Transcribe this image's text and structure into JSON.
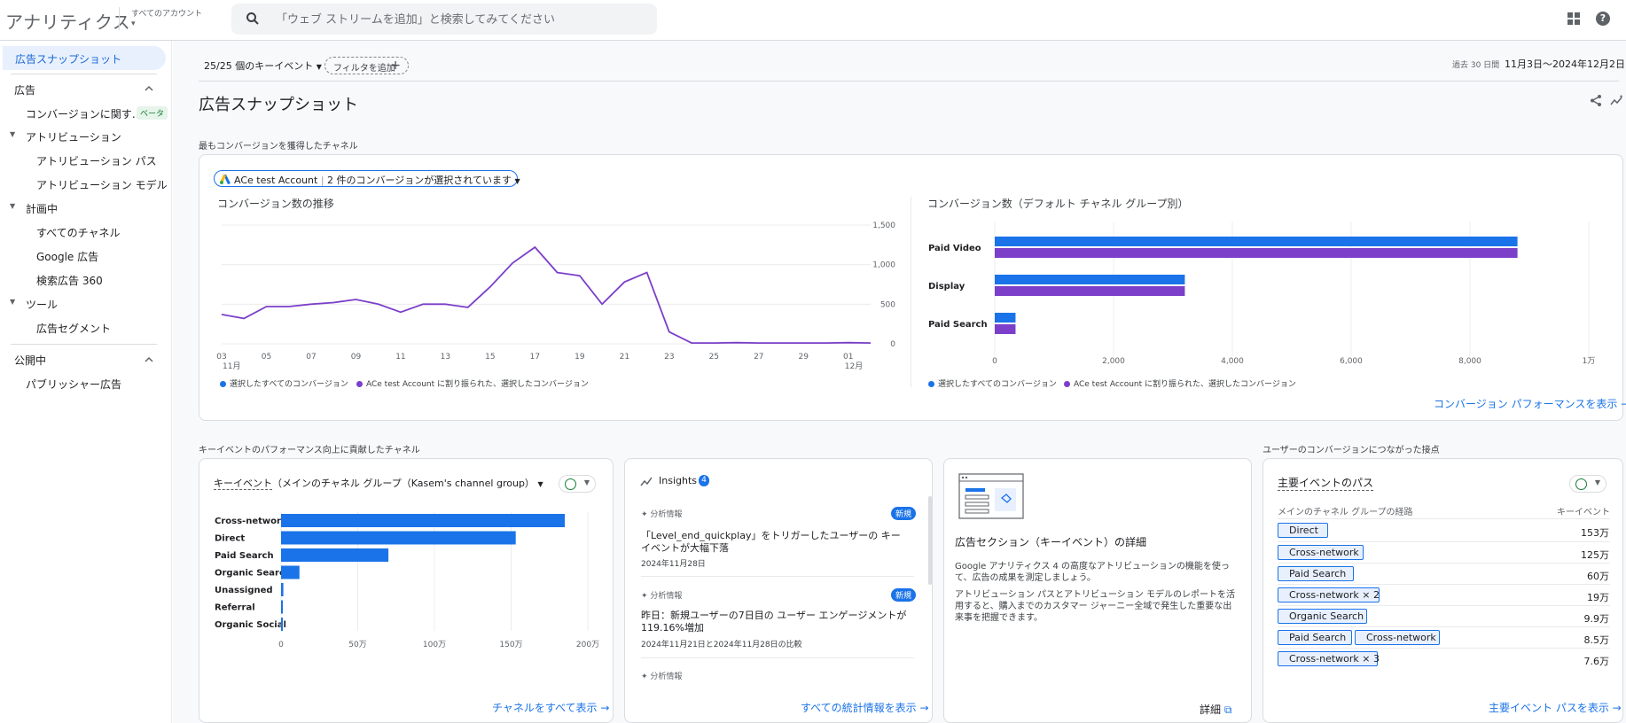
{
  "topbar": {
    "app_title": "アナリティクス",
    "account_label": "すべてのアカウント",
    "search_placeholder": "「ウェブ ストリームを追加」と検索してみてください"
  },
  "sidebar": {
    "active": "広告スナップショット",
    "section_ads": "広告",
    "conversion_item": "コンバージョンに関す…",
    "beta": "ベータ",
    "attribution": "アトリビューション",
    "attribution_paths": "アトリビューション パス",
    "attribution_model": "アトリビューション モデル",
    "planning": "計画中",
    "all_channels": "すべてのチャネル",
    "google_ads": "Google 広告",
    "sa360": "検索広告 360",
    "tools": "ツール",
    "ad_segments": "広告セグメント",
    "publishing": "公開中",
    "publisher_ads": "パブリッシャー広告"
  },
  "controls": {
    "key_events": "25/25 個のキーイベント",
    "add_filter": "フィルタを追加",
    "date_prefix": "過去 30 日間",
    "date_range": "11月3日～2024年12月2日"
  },
  "page": {
    "title": "広告スナップショット",
    "section1": "最もコンバージョンを獲得したチャネル",
    "section2": "キーイベントのパフォーマンス向上に貢献したチャネル",
    "section3": "ユーザーのコンバージョンにつながった接点"
  },
  "top_card": {
    "account_chip": "ACe test Account",
    "account_chip_detail": "2 件のコンバージョンが選択されています",
    "line_title": "コンバージョン数の推移",
    "bar_title": "コンバージョン数（デフォルト チャネル グループ別）",
    "legend_all": "選択したすべてのコンバージョン",
    "legend_acct": "ACe test Account に割り振られた、選択したコンバージョン",
    "link": "コンバージョン パフォーマンスを表示"
  },
  "colors": {
    "blue": "#1a73e8",
    "purple": "#7b3fc9"
  },
  "chart_data": [
    {
      "type": "line",
      "title": "コンバージョン数の推移",
      "x": [
        "11月3日",
        "4",
        "5",
        "6",
        "7",
        "8",
        "9",
        "10",
        "11",
        "12",
        "13",
        "14",
        "15",
        "16",
        "17",
        "18",
        "19",
        "20",
        "21",
        "22",
        "23",
        "24",
        "25",
        "26",
        "27",
        "28",
        "29",
        "30",
        "12月1日",
        "2"
      ],
      "x_tick_labels": [
        "03",
        "05",
        "07",
        "09",
        "11",
        "13",
        "15",
        "17",
        "19",
        "21",
        "23",
        "25",
        "27",
        "29",
        "01"
      ],
      "x_month_labels": [
        "11月",
        "12月"
      ],
      "series": [
        {
          "name": "ACe test Account に割り振られた、選択したコンバージョン",
          "values": [
            370,
            320,
            470,
            470,
            500,
            520,
            560,
            500,
            400,
            500,
            500,
            460,
            720,
            1020,
            1220,
            900,
            860,
            500,
            780,
            900,
            150,
            10,
            10,
            15,
            10,
            10,
            10,
            10,
            15,
            10
          ]
        }
      ],
      "ylim": [
        0,
        1500
      ],
      "y_ticks": [
        "0",
        "500",
        "1,000",
        "1,500"
      ]
    },
    {
      "type": "bar",
      "orientation": "horizontal",
      "title": "コンバージョン数（デフォルト チャネル グループ別）",
      "categories": [
        "Paid Video",
        "Display",
        "Paid Search"
      ],
      "series": [
        {
          "name": "選択したすべてのコンバージョン",
          "values": [
            8800,
            3200,
            350
          ]
        },
        {
          "name": "ACe test Account に割り振られた、選択したコンバージョン",
          "values": [
            8800,
            3200,
            350
          ]
        }
      ],
      "xlim": [
        0,
        10000
      ],
      "x_ticks": [
        "0",
        "2,000",
        "4,000",
        "6,000",
        "8,000",
        "1万"
      ]
    },
    {
      "type": "bar",
      "orientation": "horizontal",
      "title": "キーイベント（メインのチャネル グループ（Kasem's channel group））",
      "categories": [
        "Cross-network",
        "Direct",
        "Paid Search",
        "Organic Search",
        "Unassigned",
        "Referral",
        "Organic Social"
      ],
      "values": [
        1850000,
        1530000,
        700000,
        120000,
        15000,
        5000,
        3000
      ],
      "xlim": [
        0,
        2000000
      ],
      "x_ticks": [
        "0",
        "50万",
        "100万",
        "150万",
        "200万"
      ]
    }
  ],
  "channel_card": {
    "title_metric": "キーイベント",
    "title_dim": "（メインのチャネル グループ（Kasem's channel group）",
    "link": "チャネルをすべて表示"
  },
  "insights_card": {
    "title": "Insights",
    "count": "4",
    "items": [
      {
        "label": "分析情報",
        "badge": "新規",
        "text": "「Level_end_quickplay」をトリガーしたユーザーの キーイベントが大幅下落",
        "date": "2024年11月28日"
      },
      {
        "label": "分析情報",
        "badge": "新規",
        "text": "昨日：新規ユーザーの7日目の ユーザー エンゲージメントが 119.16%増加",
        "date": "2024年11月21日と2024年11月28日の比較"
      },
      {
        "label": "分析情報"
      }
    ],
    "link": "すべての統計情報を表示"
  },
  "info_card": {
    "title": "広告セクション（キーイベント）の詳細",
    "p1": "Google アナリティクス 4 の高度なアトリビューションの機能を使って、広告の成果を測定しましょう。",
    "p2": "アトリビューション パスとアトリビューション モデルのレポートを活用すると、購入までのカスタマー ジャーニー全域で発生した重要な出来事を把握できます。",
    "link": "詳細"
  },
  "paths_card": {
    "title": "主要イベントのパス",
    "col1": "メインのチャネル グループの経路",
    "col2": "キーイベント",
    "rows": [
      {
        "p1": "Direct",
        "v": "153万"
      },
      {
        "p1": "Cross-network",
        "v": "125万"
      },
      {
        "p1": "Paid Search",
        "v": "60万"
      },
      {
        "p1": "Cross-network × 2",
        "v": "19万"
      },
      {
        "p1": "Organic Search",
        "v": "9.9万"
      },
      {
        "p1": "Paid Search",
        "p2": "Cross-network",
        "v": "8.5万"
      },
      {
        "p1": "Cross-network × 3",
        "v": "7.6万"
      }
    ],
    "link": "主要イベント パスを表示"
  }
}
